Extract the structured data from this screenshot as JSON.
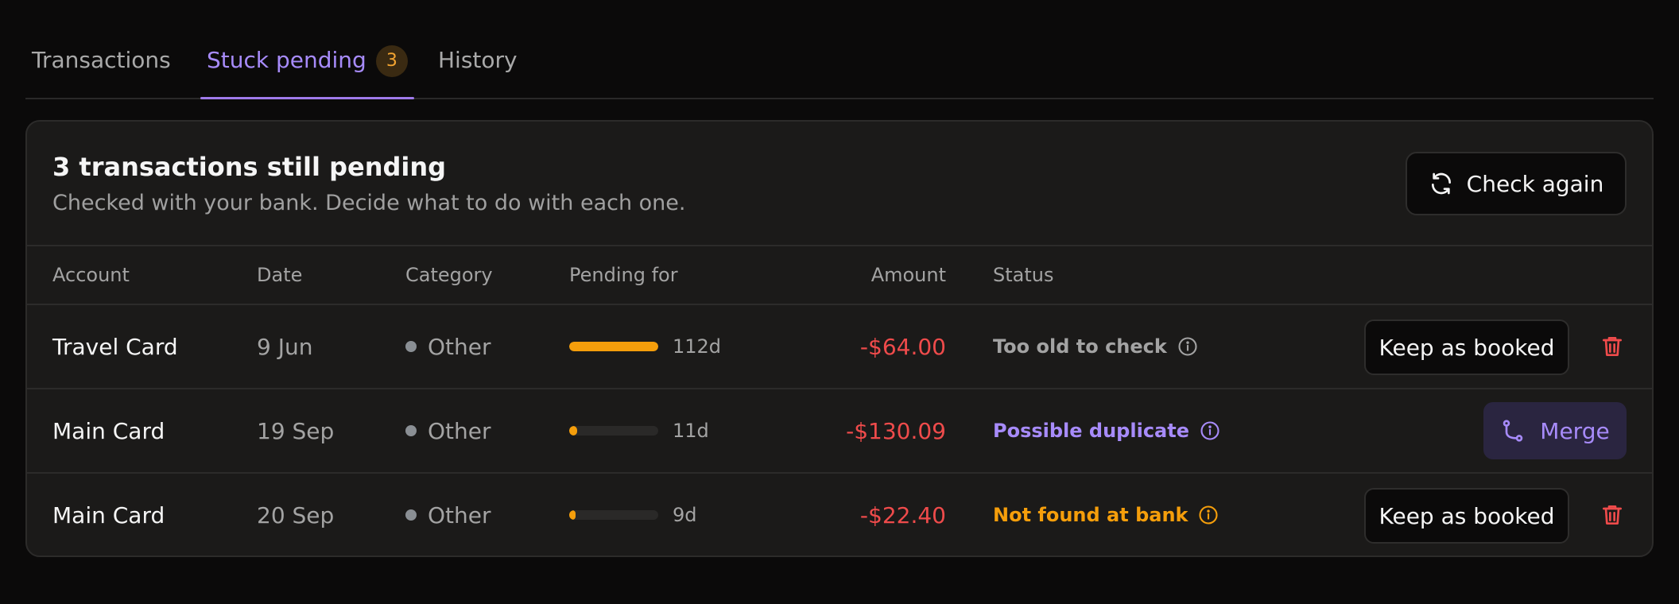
{
  "tabs": [
    {
      "label": "Transactions"
    },
    {
      "label": "Stuck pending",
      "badge": "3"
    },
    {
      "label": "History"
    }
  ],
  "panel": {
    "title": "3 transactions still pending",
    "subtitle": "Checked with your bank. Decide what to do with each one.",
    "check_again_label": "Check again"
  },
  "table": {
    "headers": {
      "account": "Account",
      "date": "Date",
      "category": "Category",
      "pending_for": "Pending for",
      "amount": "Amount",
      "status": "Status"
    },
    "rows": [
      {
        "account": "Travel Card",
        "date": "9 Jun",
        "category": "Other",
        "pending_days": "112d",
        "pending_fraction": 1.0,
        "amount": "-$64.00",
        "status": "Too old to check",
        "status_kind": "grey",
        "action": "Keep as booked"
      },
      {
        "account": "Main Card",
        "date": "19 Sep",
        "category": "Other",
        "pending_days": "11d",
        "pending_fraction": 0.09,
        "amount": "-$130.09",
        "status": "Possible duplicate",
        "status_kind": "purple",
        "action": "Merge"
      },
      {
        "account": "Main Card",
        "date": "20 Sep",
        "category": "Other",
        "pending_days": "9d",
        "pending_fraction": 0.07,
        "amount": "-$22.40",
        "status": "Not found at bank",
        "status_kind": "orange",
        "action": "Keep as booked"
      }
    ]
  },
  "colors": {
    "accent": "#a78bfa",
    "warning": "#f59e0b",
    "negative": "#ef4b4b",
    "background": "#0b0a0a",
    "panel": "#1b1a19"
  },
  "icons": {
    "check_again": "refresh-icon",
    "info": "info-icon",
    "delete": "trash-icon",
    "merge": "merge-icon"
  }
}
